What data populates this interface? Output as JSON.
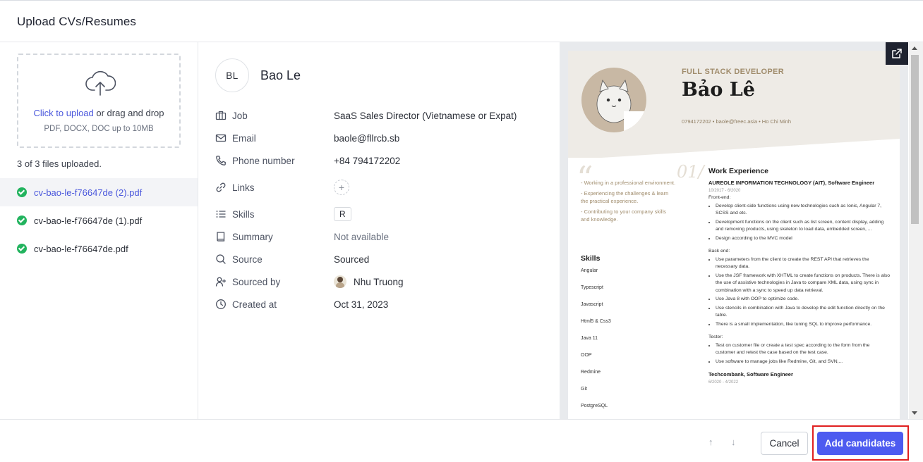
{
  "modal": {
    "title": "Upload CVs/Resumes"
  },
  "upload": {
    "link_text": "Click to upload",
    "rest_text": " or drag and drop",
    "hint": "PDF, DOCX, DOC up to 10MB",
    "status": "3 of 3 files uploaded."
  },
  "files": [
    {
      "name": "cv-bao-le-f76647de (2).pdf",
      "active": true
    },
    {
      "name": "cv-bao-le-f76647de (1).pdf",
      "active": false
    },
    {
      "name": "cv-bao-le-f76647de.pdf",
      "active": false
    }
  ],
  "candidate": {
    "initials": "BL",
    "name": "Bao Le",
    "fields": {
      "job": {
        "label": "Job",
        "value": "SaaS Sales Director (Vietnamese or Expat)"
      },
      "email": {
        "label": "Email",
        "value": "baole@fllrcb.sb"
      },
      "phone": {
        "label": "Phone number",
        "value": "+84 794172202"
      },
      "links": {
        "label": "Links",
        "value": "+"
      },
      "skills": {
        "label": "Skills",
        "value": "R"
      },
      "summary": {
        "label": "Summary",
        "value": "Not available"
      },
      "source": {
        "label": "Source",
        "value": "Sourced"
      },
      "sourced_by": {
        "label": "Sourced by",
        "value": "Nhu Truong"
      },
      "created_at": {
        "label": "Created at",
        "value": "Oct 31, 2023"
      }
    }
  },
  "cv_preview": {
    "role": "FULL STACK DEVELOPER",
    "name": "Bảo Lê",
    "contact": "0794172202 • baole@freec.asia • Ho Chi Minh",
    "quote_mark": "“",
    "section_number": "01/",
    "objectives": [
      "- Working in a professional environment.",
      "- Experiencing the challenges & learn the practical experience.",
      "- Contributing to your company skills and knowledge."
    ],
    "skills_heading": "Skills",
    "skills": [
      "Angular",
      "Typescript",
      "Javascript",
      "Html5 & Css3",
      "Java 11",
      "OOP",
      "Redmine",
      "Git",
      "PostgreSQL"
    ],
    "work_heading": "Work Experience",
    "job1": {
      "company": "AUREOLE INFORMATION TECHNOLOGY (AIT), Software Engineer",
      "dates": "10/2017 - 6/2020",
      "frontend_label": "Front-end:",
      "frontend": [
        "Develop client-side functions using new technologies such as Ionic, Angular 7, SCSS and etc.",
        "Development functions on the client such as list screen, content display, adding and removing products, using skeleton to load data, embedded screen, ...",
        "Design according to the MVC model"
      ],
      "backend_label": "Back end:",
      "backend": [
        "Use parameters from the client to create the REST API that retrieves the necessary data.",
        "Use the JSF framework with XHTML to create functions on products. There is also the use of assistive technologies in Java to compare XML data, using sync in combination with a sync to speed up data retrieval.",
        "Use Java 8 with OOP to optimize code.",
        "Use stencils in combination with Java to develop the edit function directly on the table.",
        "There is a small implementation, like tuning SQL to improve performance."
      ],
      "tester_label": "Tester:",
      "tester": [
        "Test on customer file or create a test spec according to the form from the customer and retest the case based on the test case.",
        "Use software to manage jobs like Redmine, Git, and SVN,..."
      ]
    },
    "job2": {
      "company": "Techcombank, Software Engineer",
      "dates": "6/2020 - 4/2022"
    }
  },
  "footer": {
    "up_arrow": "↑",
    "down_arrow": "↓",
    "cancel_label": "Cancel",
    "add_label": "Add candidates"
  },
  "colors": {
    "primary": "#4d5bf0",
    "success": "#22b35e",
    "highlight": "#e02020"
  }
}
